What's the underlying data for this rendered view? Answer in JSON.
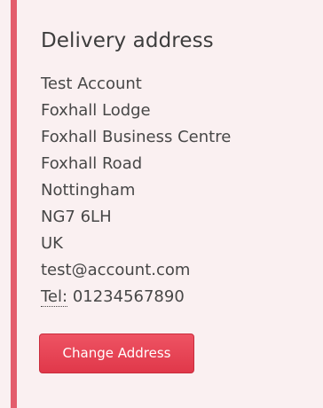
{
  "delivery": {
    "heading": "Delivery address",
    "lines": [
      "Test Account",
      "Foxhall Lodge",
      "Foxhall Business Centre",
      "Foxhall Road",
      "Nottingham",
      "NG7 6LH",
      "UK",
      "test@account.com"
    ],
    "tel_label": "Tel:",
    "tel_number": "01234567890",
    "change_button_label": "Change Address"
  },
  "colors": {
    "accent": "#e35d6c",
    "panel_background": "#faf0f1",
    "button": "#e43e50"
  }
}
